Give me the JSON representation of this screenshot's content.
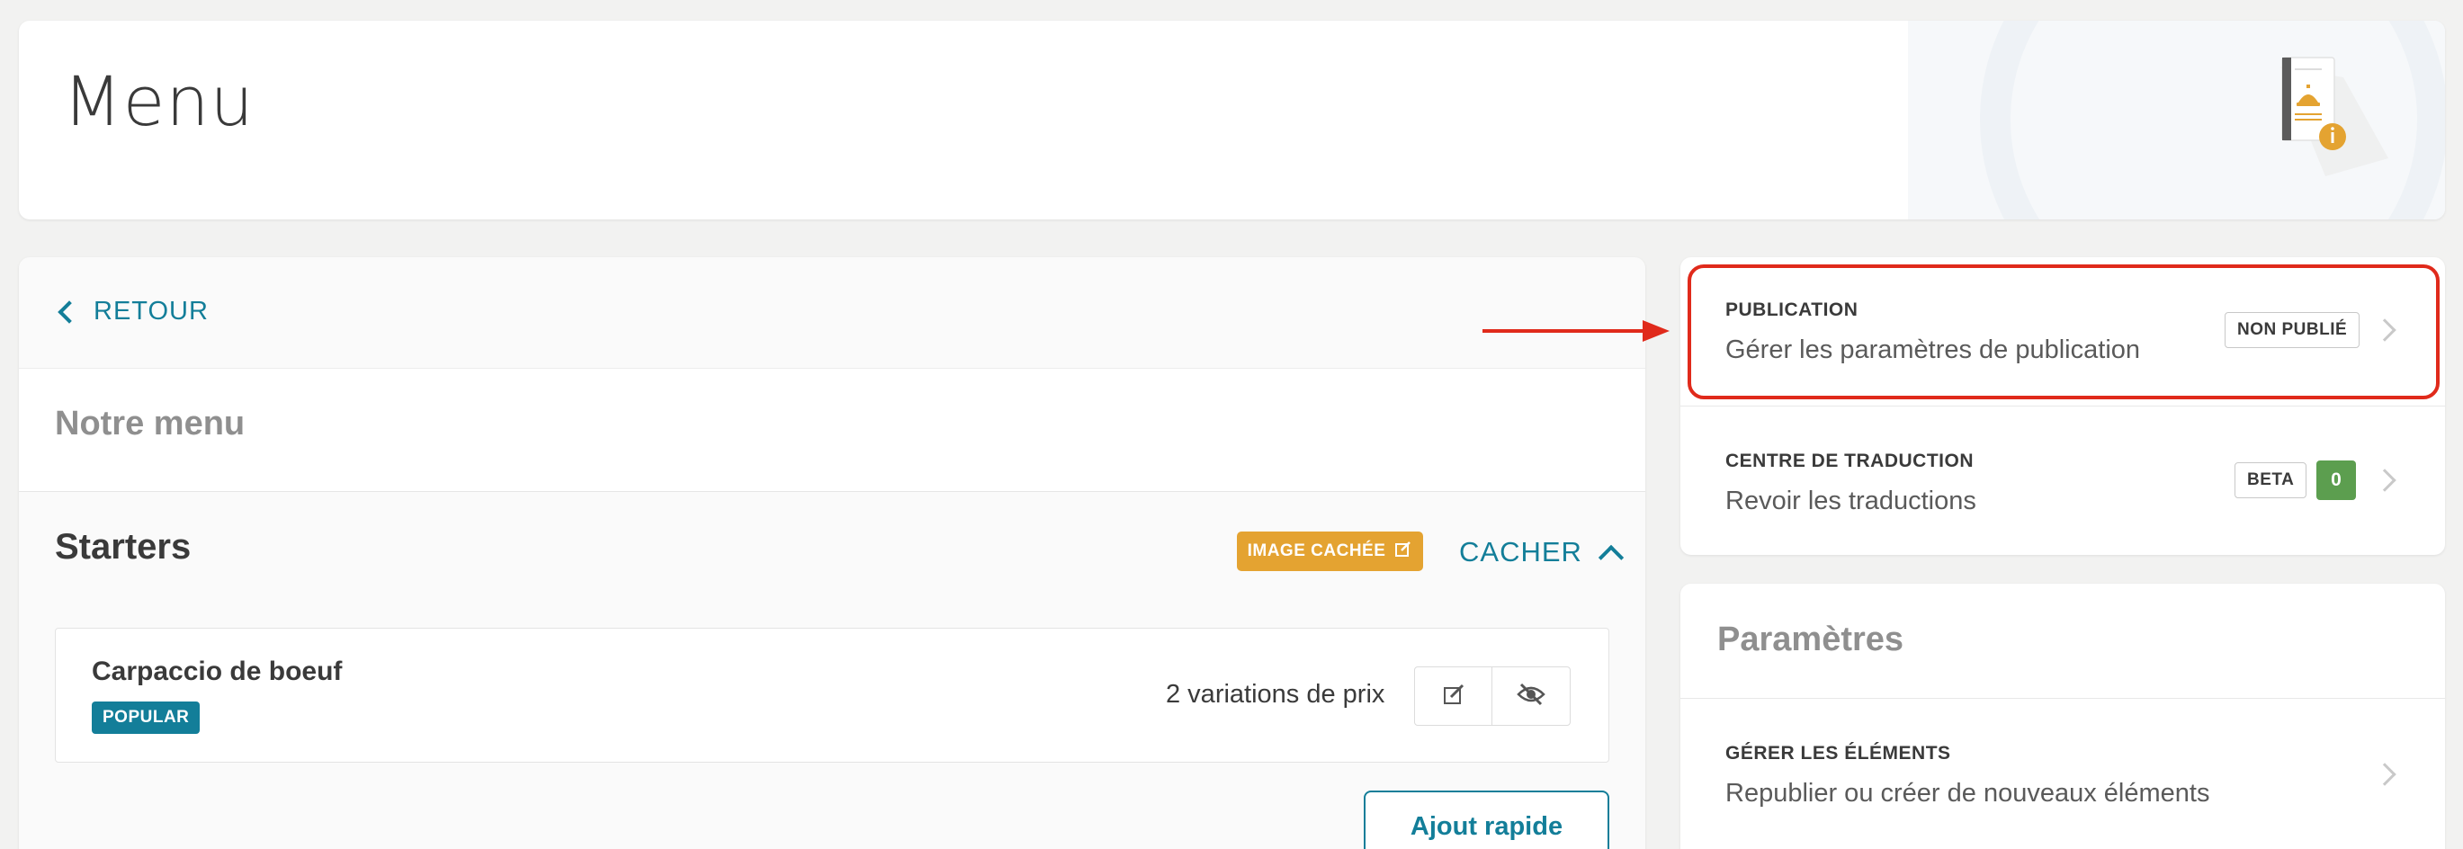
{
  "header": {
    "title": "Menu"
  },
  "left": {
    "back_label": "RETOUR",
    "menu_name": "Notre menu",
    "section": {
      "title": "Starters",
      "image_badge": "IMAGE CACHÉE",
      "toggle_label": "CACHER"
    },
    "item": {
      "name": "Carpaccio de boeuf",
      "badge": "POPULAR",
      "price_variations": "2 variations de prix"
    },
    "quick_add_label": "Ajout rapide"
  },
  "right": {
    "publication": {
      "label": "PUBLICATION",
      "description": "Gérer les paramètres de publication",
      "status_badge": "NON PUBLIÉ"
    },
    "translation": {
      "label": "CENTRE DE TRADUCTION",
      "description": "Revoir les traductions",
      "beta_badge": "BETA",
      "count": "0"
    },
    "params": {
      "title": "Paramètres",
      "manage_label": "GÉRER LES ÉLÉMENTS",
      "manage_description": "Republier ou créer de nouveaux éléments"
    }
  },
  "colors": {
    "accent": "#137e99",
    "warning": "#e4a331",
    "success": "#5c9e4f",
    "highlight": "#e02a1b"
  },
  "icons": [
    "chevron-left-icon",
    "chevron-up-icon",
    "edit-icon",
    "eye-off-icon",
    "chevron-right-icon",
    "menu-illustration-icon"
  ]
}
